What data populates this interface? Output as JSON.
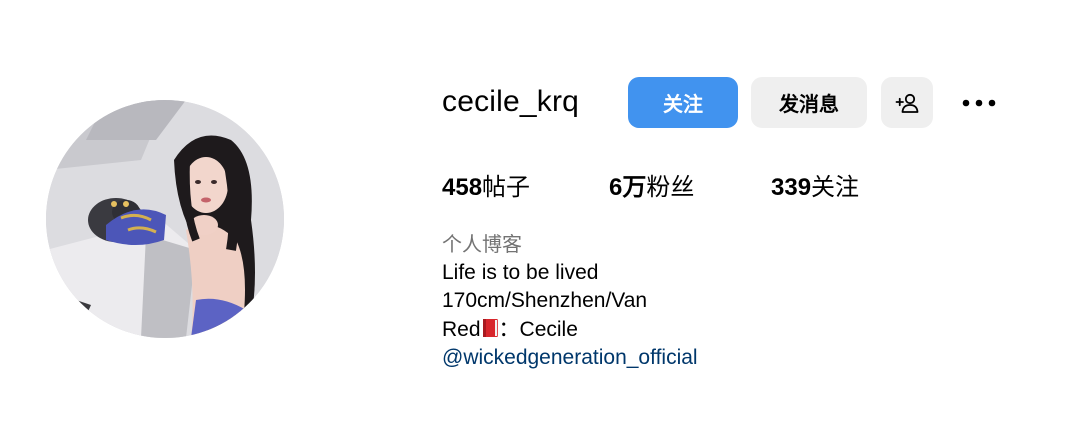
{
  "profile": {
    "username": "cecile_krq",
    "avatar_alt": "cecile_krq"
  },
  "actions": {
    "follow_label": "关注",
    "message_label": "发消息",
    "suggest_icon": "add-person-icon",
    "more_icon": "more-horizontal-icon"
  },
  "stats": {
    "posts_count": "458",
    "posts_label": "帖子",
    "followers_count": "6万",
    "followers_label": "粉丝",
    "following_count": "339",
    "following_label": "关注"
  },
  "bio": {
    "category": "个人博客",
    "line1": "Life is to be lived",
    "line2": "170cm/Shenzhen/Van",
    "line3_prefix": "Red",
    "line3_icon": "red-book-emoji",
    "line3_suffix": "：Cecile",
    "link": "@wickedgeneration_official"
  },
  "colors": {
    "follow_button": "#4193ef",
    "secondary_button": "#efefef",
    "link": "#00376b",
    "category": "#737373"
  }
}
